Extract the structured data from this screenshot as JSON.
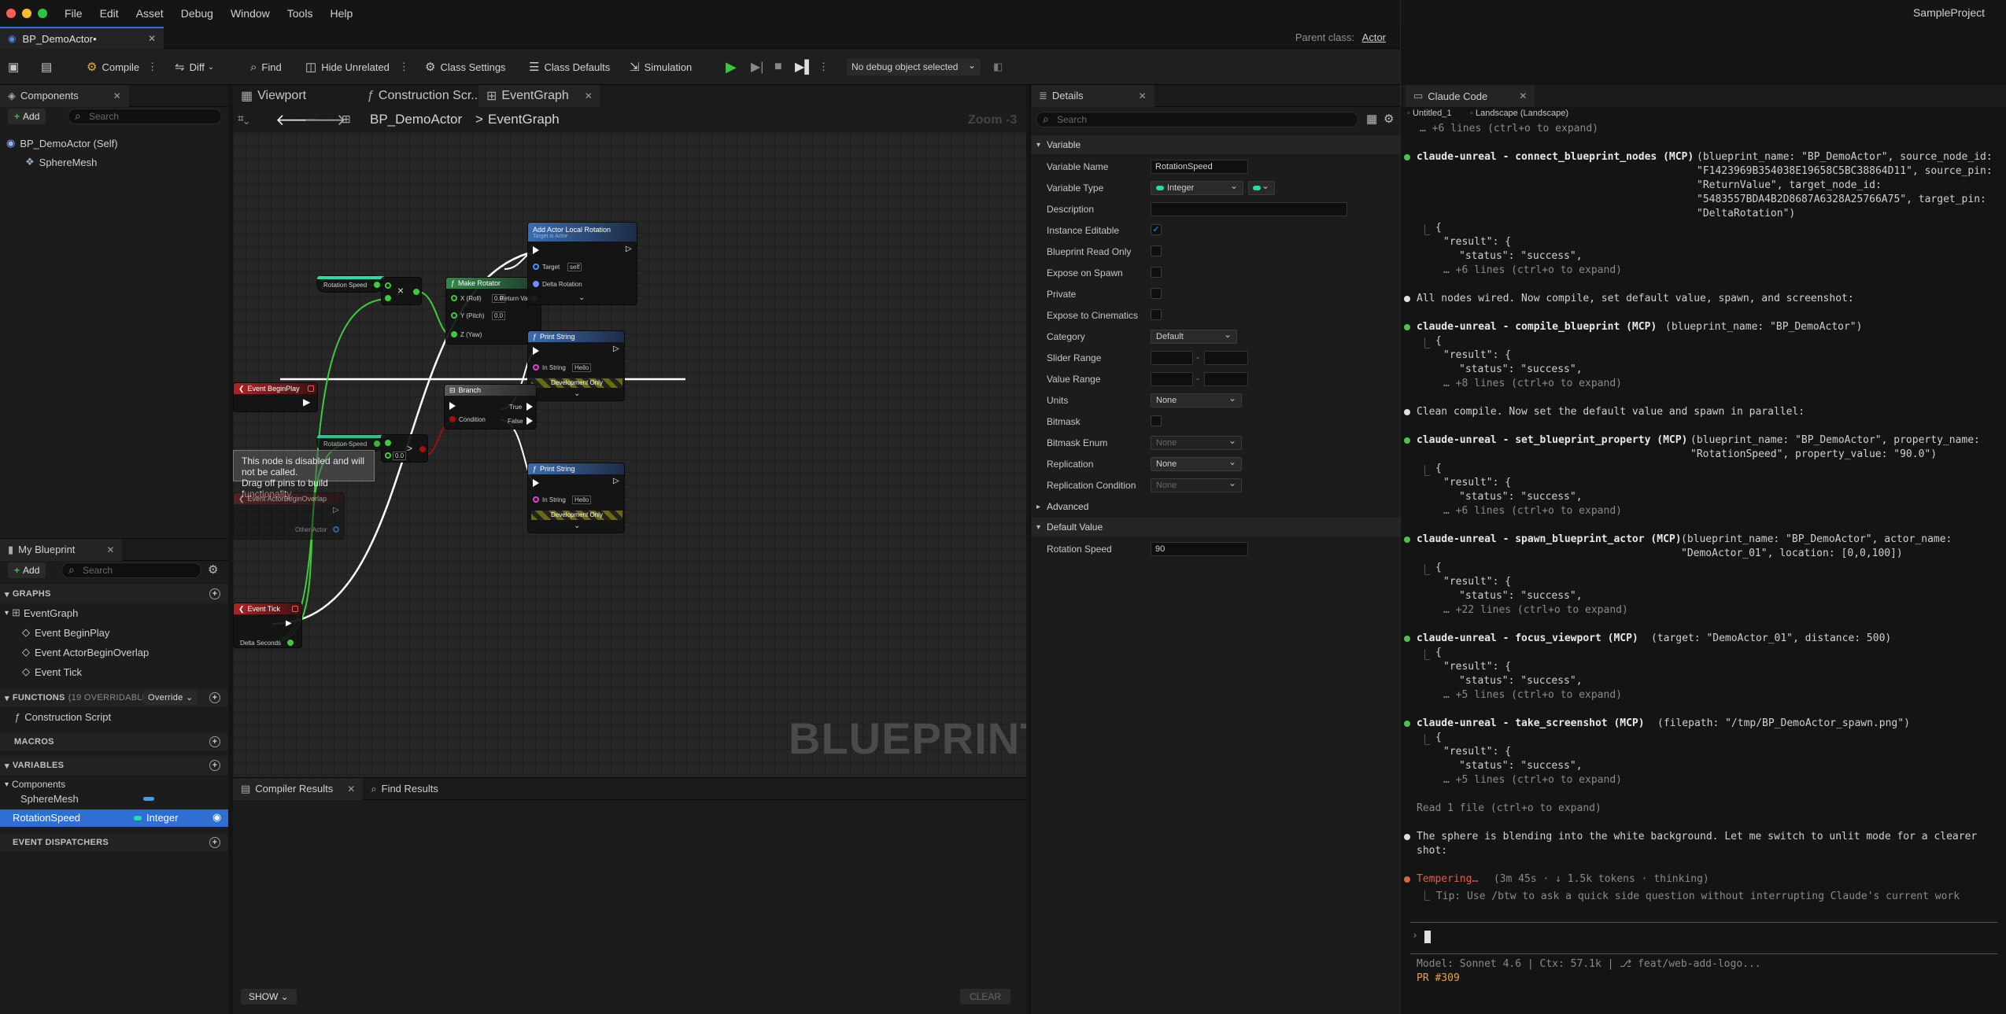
{
  "menu": {
    "items": [
      "File",
      "Edit",
      "Asset",
      "Debug",
      "Window",
      "Tools",
      "Help"
    ]
  },
  "doc_tab": {
    "label": "BP_DemoActor•"
  },
  "parent_class": {
    "label": "Parent class:",
    "value": "Actor"
  },
  "toolbar": {
    "compile": "Compile",
    "diff": "Diff",
    "find": "Find",
    "hide_unrelated": "Hide Unrelated",
    "class_settings": "Class Settings",
    "class_defaults": "Class Defaults",
    "simulation": "Simulation",
    "debug_object": "No debug object selected"
  },
  "components": {
    "tab": "Components",
    "add": "Add",
    "search_placeholder": "Search",
    "items": [
      "BP_DemoActor (Self)",
      "SphereMesh"
    ]
  },
  "graph_tabs": {
    "viewport": "Viewport",
    "construction": "Construction Scr...",
    "eventgraph": "EventGraph"
  },
  "breadcrumb": {
    "root": "BP_DemoActor",
    "sep": ">",
    "leaf": "EventGraph",
    "zoom": "Zoom -3"
  },
  "nodes": {
    "add_rot": {
      "title": "Add Actor Local Rotation",
      "sub": "Target is Actor",
      "target": "Target",
      "self": "self",
      "delta": "Delta Rotation"
    },
    "make_rot": {
      "title": "Make Rotator",
      "x": "X (Roll)",
      "y": "Y (Pitch)",
      "z": "Z (Yaw)",
      "xv": "0.0",
      "yv": "0.0",
      "ret": "Return Value"
    },
    "rot_speed_1": {
      "label": "Rotation Speed"
    },
    "rot_speed_2": {
      "label": "Rotation Speed"
    },
    "multiply": {
      "op": "×"
    },
    "begin_play": {
      "title": "Event BeginPlay"
    },
    "branch": {
      "title": "Branch",
      "cond": "Condition",
      "true": "True",
      "false": "False"
    },
    "print1": {
      "title": "Print String",
      "in": "In String",
      "val": "Hello",
      "dev": "Development Only"
    },
    "print2": {
      "title": "Print String",
      "in": "In String",
      "val": "Hello",
      "dev": "Development Only"
    },
    "overlap": {
      "title": "Event ActorBeginOverlap",
      "pin": "Other Actor"
    },
    "tick": {
      "title": "Event Tick",
      "pin": "Delta Seconds"
    },
    "tooltip": {
      "line1": "This node is disabled and will not be called.",
      "line2": "Drag off pins to build functionality."
    },
    "compare": {
      "val": "0.0",
      "op": ">"
    }
  },
  "watermark": "BLUEPRINT",
  "my_blueprint": {
    "tab": "My Blueprint",
    "add": "Add",
    "search_placeholder": "Search",
    "graphs_hdr": "GRAPHS",
    "eventgraph": "EventGraph",
    "events": [
      "Event BeginPlay",
      "Event ActorBeginOverlap",
      "Event Tick"
    ],
    "functions_hdr": "FUNCTIONS",
    "functions_count": "(19 OVERRIDABLE)",
    "override": "Override",
    "construction": "Construction Script",
    "macros_hdr": "MACROS",
    "variables_hdr": "VARIABLES",
    "components_group": "Components",
    "spheremesh": "SphereMesh",
    "rotation_speed": "RotationSpeed",
    "rotation_speed_type": "Integer",
    "dispatchers_hdr": "EVENT DISPATCHERS"
  },
  "bottom": {
    "compiler": "Compiler Results",
    "find": "Find Results",
    "show": "SHOW",
    "clear": "CLEAR"
  },
  "details": {
    "tab": "Details",
    "search_placeholder": "Search",
    "variable_hdr": "Variable",
    "rows": {
      "name_lbl": "Variable Name",
      "name_val": "RotationSpeed",
      "type_lbl": "Variable Type",
      "type_val": "Integer",
      "desc_lbl": "Description",
      "inst_lbl": "Instance Editable",
      "ro_lbl": "Blueprint Read Only",
      "spawn_lbl": "Expose on Spawn",
      "priv_lbl": "Private",
      "cine_lbl": "Expose to Cinematics",
      "cat_lbl": "Category",
      "cat_val": "Default",
      "slider_lbl": "Slider Range",
      "dash": "-",
      "value_lbl": "Value Range",
      "units_lbl": "Units",
      "units_val": "None",
      "bitmask_lbl": "Bitmask",
      "bitmask_enum_lbl": "Bitmask Enum",
      "bitmask_enum_val": "None",
      "repl_lbl": "Replication",
      "repl_val": "None",
      "repl_cond_lbl": "Replication Condition",
      "repl_cond_val": "None"
    },
    "advanced_hdr": "Advanced",
    "default_hdr": "Default Value",
    "default_lbl": "Rotation Speed",
    "default_val": "90"
  },
  "claude": {
    "window_title": "SampleProject",
    "tab": "Claude Code",
    "tabs": [
      "Untitled_1",
      "Landscape (Landscape)"
    ],
    "lines": {
      "l0": "⎿ +6 lines (ctrl+o to expand)",
      "connect_a": "claude-unreal - connect_blueprint_nodes (MCP)",
      "connect_b": "(blueprint_name: \"BP_DemoActor\", source_node_id:",
      "connect_c": "\"F1423969B354038E19658C5BC38864D11\", source_pin:",
      "connect_d": "\"ReturnValue\", target_node_id:",
      "connect_e": "\"5483557BDA4B2D8687A6328A25766A75\", target_pin:",
      "connect_f": "\"DeltaRotation\")",
      "brace": "{",
      "result": "\"result\": {",
      "status": "\"status\": \"success\",",
      "more6": "… +6 lines (ctrl+o to expand)",
      "wired": "All nodes wired. Now compile, set default value, spawn, and screenshot:",
      "compile_a": "claude-unreal - compile_blueprint (MCP)",
      "compile_b": "(blueprint_name: \"BP_DemoActor\")",
      "more8": "… +8 lines (ctrl+o to expand)",
      "clean": "Clean compile. Now set the default value and spawn in parallel:",
      "setprop_a": "claude-unreal - set_blueprint_property (MCP)",
      "setprop_b": "(blueprint_name: \"BP_DemoActor\", property_name:",
      "setprop_c": "\"RotationSpeed\", property_value: \"90.0\")",
      "spawn_a": "claude-unreal - spawn_blueprint_actor (MCP)",
      "spawn_b": "(blueprint_name: \"BP_DemoActor\", actor_name:",
      "spawn_c": "\"DemoActor_01\", location: [0,0,100])",
      "more22": "… +22 lines (ctrl+o to expand)",
      "focus_a": "claude-unreal - focus_viewport (MCP)",
      "focus_b": "(target: \"DemoActor_01\", distance: 500)",
      "more5": "… +5 lines (ctrl+o to expand)",
      "shot_a": "claude-unreal - take_screenshot (MCP)",
      "shot_b": "(filepath: \"/tmp/BP_DemoActor_spawn.png\")",
      "read": "Read 1 file (ctrl+o to expand)",
      "blend1": "The sphere is blending into the white background. Let me switch to unlit mode for a clearer",
      "blend2": "shot:",
      "temper_a": "Tempering…",
      "temper_b": " (3m 45s · ↓ 1.5k tokens · thinking)",
      "tip": "⎿ Tip: Use /btw to ask a quick side question without interrupting Claude's current work",
      "status_bar": "Model: Sonnet 4.6 | Ctx: 57.1k | ⎇ feat/web-add-logo...",
      "pr": "PR #309"
    }
  }
}
